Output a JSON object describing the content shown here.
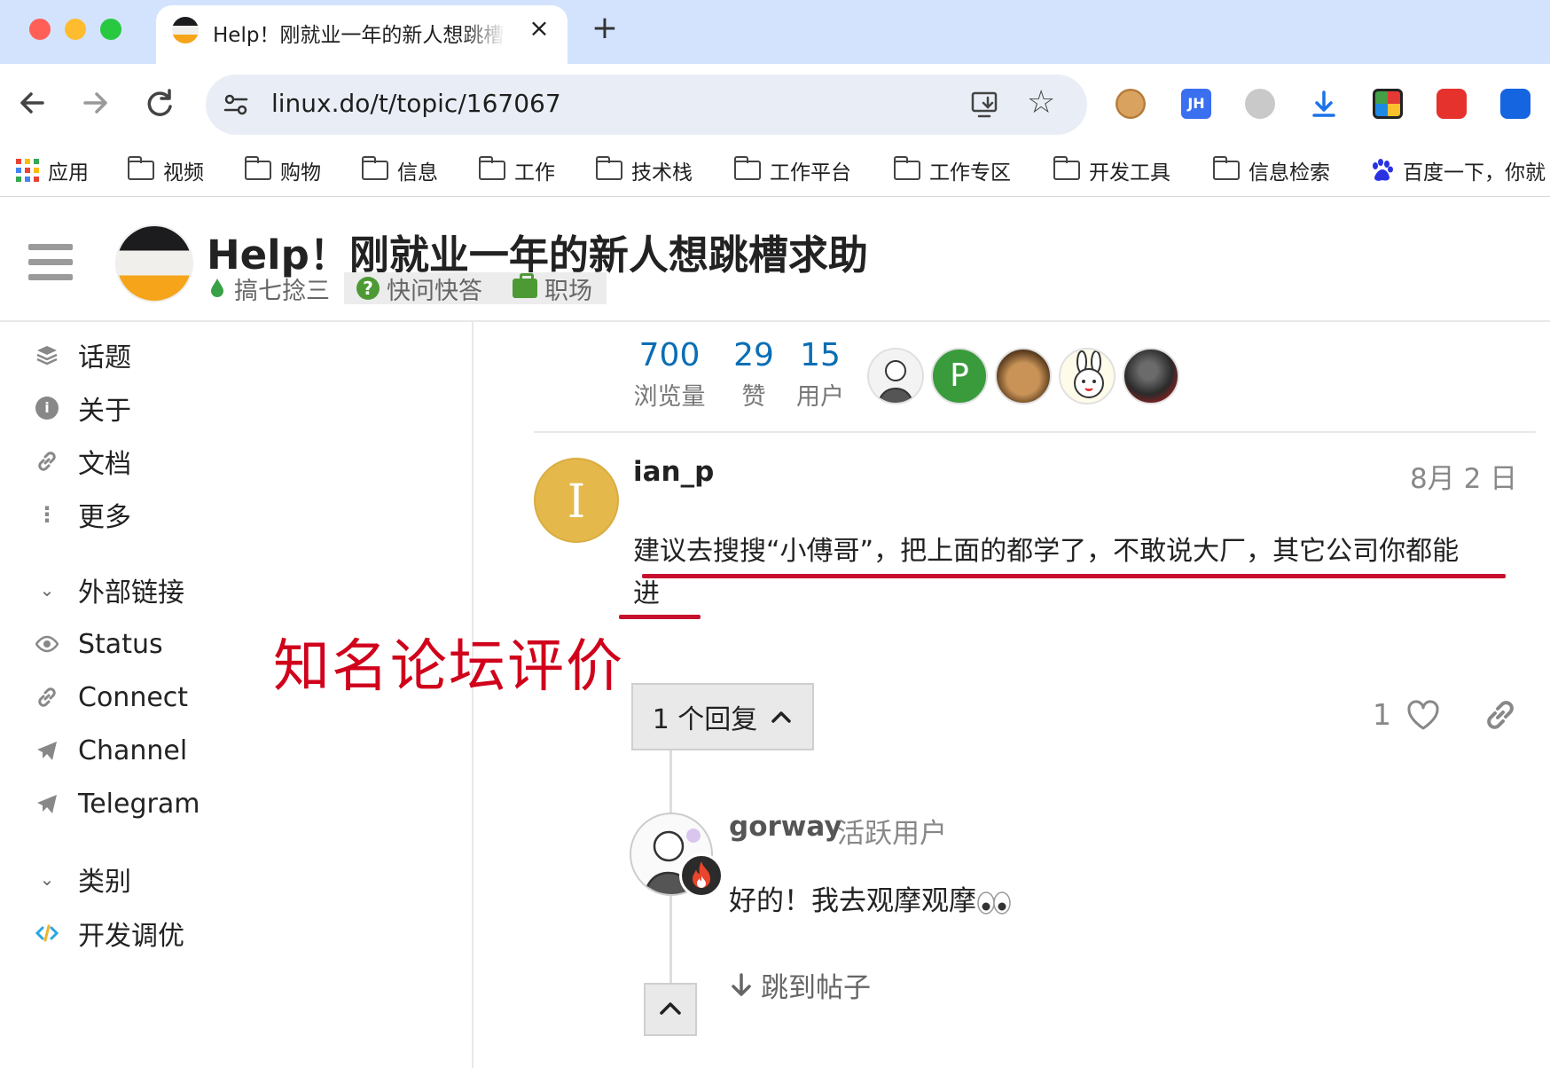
{
  "browser": {
    "tab_title": "Help！刚就业一年的新人想跳槽求助",
    "tab_close": "×",
    "new_tab": "+",
    "url": "linux.do/t/topic/167067",
    "bookmarks": [
      "应用",
      "视频",
      "购物",
      "信息",
      "工作",
      "技术栈",
      "工作平台",
      "工作专区",
      "开发工具",
      "信息检索",
      "百度一下，你就"
    ]
  },
  "header": {
    "title": "Help！刚就业一年的新人想跳槽求助",
    "category": "搞七捻三",
    "tags": [
      "快问快答",
      "职场"
    ]
  },
  "sidebar": {
    "items": [
      "话题",
      "关于",
      "文档",
      "更多"
    ],
    "external_heading": "外部链接",
    "external_links": [
      "Status",
      "Connect",
      "Channel",
      "Telegram"
    ],
    "categories_heading": "类别",
    "categories": [
      "开发调优"
    ]
  },
  "annotation": "知名论坛评价",
  "stats": [
    {
      "value": "700",
      "label": "浏览量"
    },
    {
      "value": "29",
      "label": "赞"
    },
    {
      "value": "15",
      "label": "用户"
    }
  ],
  "participants": [
    {
      "initial": "P",
      "color": "#3a9b3d"
    }
  ],
  "post": {
    "avatar_letter": "I",
    "username": "ian_p",
    "date": "8月 2 日",
    "body_line1": "建议去搜搜“小傅哥”，把上面的都学了，不敢说大厂，其它公司你都能",
    "body_line2": "进",
    "reply_count_label": "1 个回复",
    "likes": "1"
  },
  "reply": {
    "username": "gorway",
    "user_title": "活跃用户",
    "body": "好的！我去观摩观摩",
    "jump_label": "跳到帖子"
  },
  "colors": {
    "link_blue": "#0a6eb5",
    "annotation_red": "#d0021b",
    "category_green": "#4d9a35",
    "avatar_gold": "#e4b84a"
  }
}
